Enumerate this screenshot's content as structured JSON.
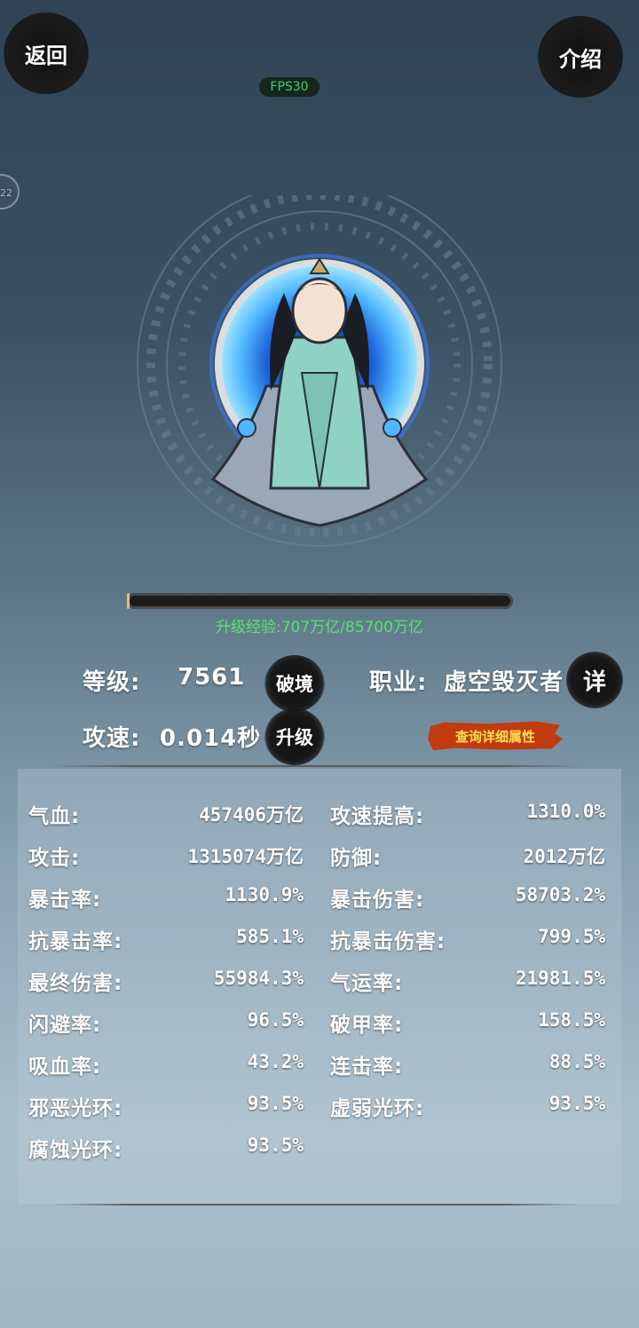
{
  "header": {
    "back_label": "返回",
    "intro_label": "介绍",
    "fps_label": "FPS30",
    "side_badge": "22"
  },
  "experience": {
    "label": "升级经验:",
    "current": "707万亿",
    "separator": "/",
    "max": "85700万亿",
    "progress_fraction": 0.008
  },
  "profile": {
    "level_label": "等级:",
    "level_value": "7561",
    "breakthrough_label": "破境",
    "class_label": "职业:",
    "class_value": "虚空毁灭者",
    "class_detail_label": "详",
    "attack_speed_label": "攻速:",
    "attack_speed_value": "0.014秒",
    "upgrade_label": "升级",
    "detail_attr_label": "查询详细属性"
  },
  "stats": {
    "left": [
      {
        "label": "气血:",
        "value": "457406万亿"
      },
      {
        "label": "攻击:",
        "value": "1315074万亿"
      },
      {
        "label": "暴击率:",
        "value": "1130.9%"
      },
      {
        "label": "抗暴击率:",
        "value": "585.1%"
      },
      {
        "label": "最终伤害:",
        "value": "55984.3%"
      },
      {
        "label": "闪避率:",
        "value": "96.5%"
      },
      {
        "label": "吸血率:",
        "value": "43.2%"
      },
      {
        "label": "邪恶光环:",
        "value": "93.5%"
      },
      {
        "label": "腐蚀光环:",
        "value": "93.5%"
      }
    ],
    "right": [
      {
        "label": "攻速提高:",
        "value": "1310.0%"
      },
      {
        "label": "防御:",
        "value": "2012万亿"
      },
      {
        "label": "暴击伤害:",
        "value": "58703.2%"
      },
      {
        "label": "抗暴击伤害:",
        "value": "799.5%"
      },
      {
        "label": "气运率:",
        "value": "21981.5%"
      },
      {
        "label": "破甲率:",
        "value": "158.5%"
      },
      {
        "label": "连击率:",
        "value": "88.5%"
      },
      {
        "label": "虚弱光环:",
        "value": "93.5%"
      }
    ]
  },
  "colors": {
    "exp_text": "#58e36b",
    "fps_text": "#3fd16a",
    "detail_btn_bg": "#c23a10",
    "detail_btn_text": "#ffe14a"
  }
}
